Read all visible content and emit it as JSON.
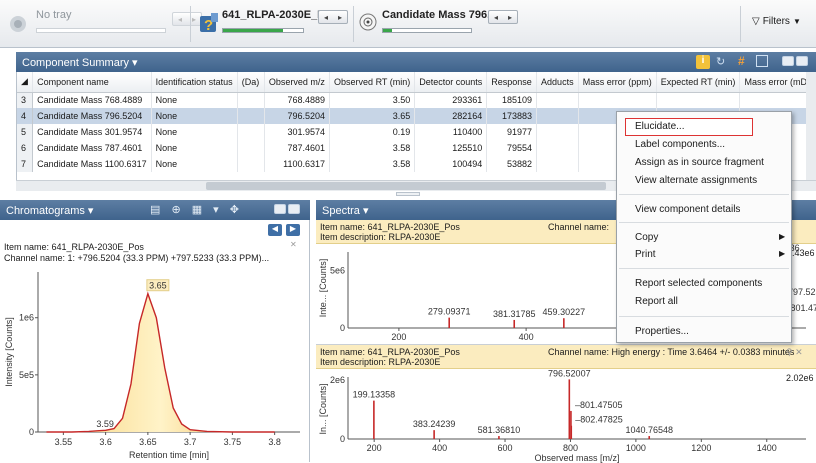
{
  "toolbar": {
    "tray_label": "No tray",
    "sample_name": "641_RLPA-2030E_Pos",
    "sample_progress": 0.75,
    "component_name": "Candidate Mass 796....",
    "component_progress": 0.1,
    "filters_label": "Filters"
  },
  "component_summary": {
    "title": "Component Summary",
    "columns": [
      "Component name",
      "Identification status",
      "(Da)",
      "Observed m/z",
      "Observed RT (min)",
      "Detector counts",
      "Response",
      "Adducts",
      "Mass error (ppm)",
      "Expected RT (min)",
      "Mass error (mDa"
    ],
    "rows": [
      {
        "n": "3",
        "name": "Candidate Mass 768.4889",
        "status": "None",
        "mz": "768.4889",
        "rt": "3.50",
        "counts": "293361",
        "response": "185109"
      },
      {
        "n": "4",
        "name": "Candidate Mass 796.5204",
        "status": "None",
        "mz": "796.5204",
        "rt": "3.65",
        "counts": "282164",
        "response": "173883"
      },
      {
        "n": "5",
        "name": "Candidate Mass 301.9574",
        "status": "None",
        "mz": "301.9574",
        "rt": "0.19",
        "counts": "110400",
        "response": "91977"
      },
      {
        "n": "6",
        "name": "Candidate Mass 787.4601",
        "status": "None",
        "mz": "787.4601",
        "rt": "3.58",
        "counts": "125510",
        "response": "79554"
      },
      {
        "n": "7",
        "name": "Candidate Mass 1100.6317",
        "status": "None",
        "mz": "1100.6317",
        "rt": "3.58",
        "counts": "100494",
        "response": "53882"
      }
    ]
  },
  "context_menu": {
    "items": [
      "Elucidate...",
      "Label components...",
      "Assign as in source fragment",
      "View alternate assignments",
      "View component details",
      "Copy",
      "Print",
      "Report selected components",
      "Report all",
      "Properties..."
    ]
  },
  "chromatograms": {
    "title": "Chromatograms",
    "item_name": "Item name: 641_RLPA-2030E_Pos",
    "channel_name": "Channel name: 1: +796.5204 (33.3 PPM) +797.5233 (33.3 PPM)...",
    "ylabel": "Intensity [Counts]",
    "xlabel": "Retention time [min]",
    "peak_label": "3.65",
    "minor_label": "3.59"
  },
  "spectra": {
    "title": "Spectra",
    "top": {
      "item_name": "Item name: 641_RLPA-2030E_Pos",
      "item_desc": "Item description: RLPA-2030E",
      "channel": "Channel name:",
      "ylabel": "Inte... [Counts]",
      "max_label": ".43e6"
    },
    "bottom": {
      "item_name": "Item name: 641_RLPA-2030E_Pos",
      "item_desc": "Item description: RLPA-2030E",
      "channel": "Channel name: High energy : Time 3.6464 +/- 0.0383 minutes",
      "ylabel": "In... [Counts]",
      "max_label": "2.02e6",
      "xlabel": "Observed mass [m/z]"
    }
  },
  "chart_data": [
    {
      "type": "line",
      "xlabel": "Retention time [min]",
      "ylabel": "Intensity [Counts]",
      "xlim": [
        3.52,
        3.83
      ],
      "ylim": [
        0,
        1400000
      ],
      "x_ticks": [
        "3.55",
        "3.6",
        "3.65",
        "3.7",
        "3.75",
        "3.8"
      ],
      "y_ticks": [
        "1e6",
        "5e5",
        "0"
      ],
      "x": [
        3.53,
        3.56,
        3.58,
        3.59,
        3.6,
        3.61,
        3.62,
        3.63,
        3.64,
        3.65,
        3.66,
        3.67,
        3.68,
        3.69,
        3.7,
        3.72,
        3.75,
        3.8
      ],
      "y": [
        0,
        0,
        5000,
        10000,
        15000,
        30000,
        120000,
        420000,
        950000,
        1210000,
        1000000,
        560000,
        210000,
        70000,
        20000,
        5000,
        0,
        0
      ],
      "annotations": [
        {
          "x": 3.65,
          "label": "3.65"
        },
        {
          "x": 3.59,
          "label": "3.59"
        }
      ]
    },
    {
      "type": "bar",
      "title": "Spectrum (top)",
      "xlim": [
        120,
        840
      ],
      "ylim": [
        0,
        6600000
      ],
      "x_ticks": [
        "200",
        "400",
        "600",
        "800"
      ],
      "y_ticks": [
        "5e6",
        "0"
      ],
      "peaks": [
        {
          "mz": 279.09371,
          "v": 900000,
          "label": "279.09371"
        },
        {
          "mz": 381.31785,
          "v": 700000,
          "label": "381.31785"
        },
        {
          "mz": 459.30227,
          "v": 850000,
          "label": "459.30227"
        },
        {
          "mz": 662.44841,
          "v": 450000,
          "label": "662.44841"
        },
        {
          "mz": 796.52036,
          "v": 6430000,
          "label": "796.52036"
        },
        {
          "mz": 797.5233,
          "v": 2600000,
          "label": "797.5233"
        },
        {
          "mz": 801.475,
          "v": 1200000,
          "label": "801.475"
        }
      ]
    },
    {
      "type": "bar",
      "title": "Spectrum (bottom, high energy)",
      "xlabel": "Observed mass [m/z]",
      "xlim": [
        120,
        1520
      ],
      "ylim": [
        0,
        2100000
      ],
      "x_ticks": [
        "200",
        "400",
        "600",
        "800",
        "1000",
        "1200",
        "1400"
      ],
      "y_ticks": [
        "2e6",
        "0"
      ],
      "peaks": [
        {
          "mz": 199.13358,
          "v": 1300000,
          "label": "199.13358"
        },
        {
          "mz": 383.24239,
          "v": 300000,
          "label": "383.24239"
        },
        {
          "mz": 581.3681,
          "v": 100000,
          "label": "581.36810"
        },
        {
          "mz": 796.52007,
          "v": 2020000,
          "label": "796.52007"
        },
        {
          "mz": 801.47505,
          "v": 950000,
          "label": "801.47505"
        },
        {
          "mz": 802.47825,
          "v": 450000,
          "label": "802.47825"
        },
        {
          "mz": 1040.76548,
          "v": 100000,
          "label": "1040.76548"
        }
      ]
    }
  ]
}
